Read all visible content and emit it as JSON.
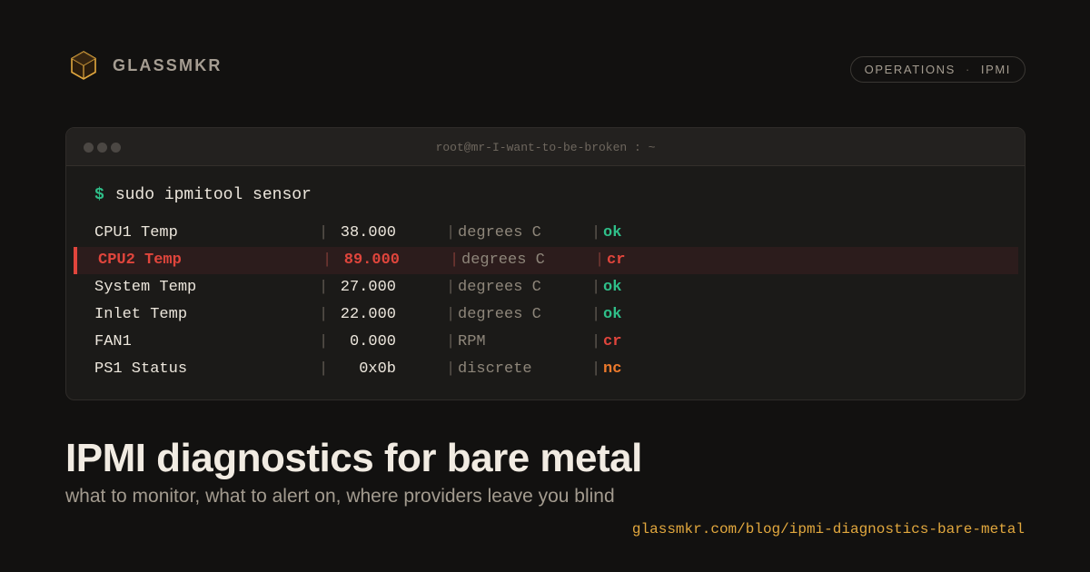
{
  "brand": {
    "name": "GLASSMKR",
    "logo_icon": "hexagon-cube-icon",
    "accent": "#e2a83e"
  },
  "tag": {
    "left": "OPERATIONS",
    "separator": "·",
    "right": "IPMI"
  },
  "terminal": {
    "title": "root@mr-I-want-to-be-broken : ~",
    "prompt": "$",
    "command": "sudo ipmitool sensor",
    "rows": [
      {
        "name": "CPU1 Temp",
        "value": "38.000",
        "unit": "degrees C",
        "status": "ok",
        "highlighted": false
      },
      {
        "name": "CPU2 Temp",
        "value": "89.000",
        "unit": "degrees C",
        "status": "cr",
        "highlighted": true
      },
      {
        "name": "System Temp",
        "value": "27.000",
        "unit": "degrees C",
        "status": "ok",
        "highlighted": false
      },
      {
        "name": "Inlet Temp",
        "value": "22.000",
        "unit": "degrees C",
        "status": "ok",
        "highlighted": false
      },
      {
        "name": "FAN1",
        "value": "0.000",
        "unit": "RPM",
        "status": "cr",
        "highlighted": false
      },
      {
        "name": "PS1 Status",
        "value": "0x0b",
        "unit": "discrete",
        "status": "nc",
        "highlighted": false
      }
    ],
    "divider": "|",
    "colors": {
      "ok": "#2fbf89",
      "cr": "#e0453c",
      "nc": "#ee7a2c"
    }
  },
  "headline": "IPMI diagnostics for bare metal",
  "subline": "what to monitor, what to alert on, where providers leave you blind",
  "url": "glassmkr.com/blog/ipmi-diagnostics-bare-metal"
}
